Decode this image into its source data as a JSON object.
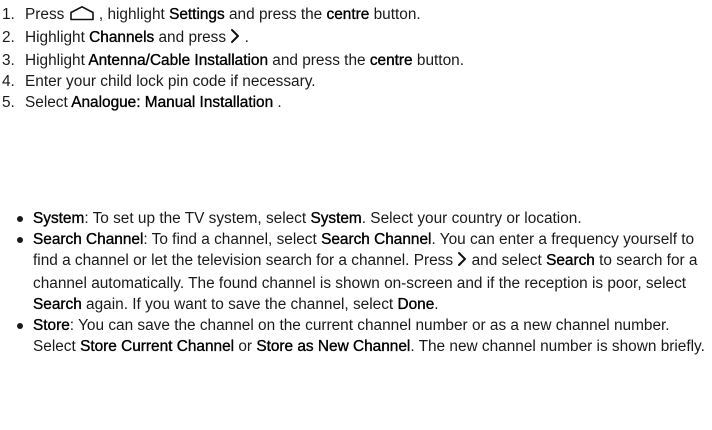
{
  "steps": [
    {
      "num": "1.",
      "t1": "Press ",
      "icon": "home-icon",
      "t2": ", highlight ",
      "k1": "Settings",
      "t3": " and press the ",
      "k2": "centre",
      "t4": " button."
    },
    {
      "num": "2.",
      "t1": "Highlight ",
      "k1": "Channels",
      "t2": " and press ",
      "icon": "chevron-right-icon",
      "t3": "."
    },
    {
      "num": "3.",
      "t1": "Highlight ",
      "k1": "Antenna/Cable Installation",
      "t2": " and press the ",
      "k2": "centre",
      "t3": " button."
    },
    {
      "num": "4.",
      "t1": "Enter your child lock pin code if necessary."
    },
    {
      "num": "5.",
      "t1": "Select ",
      "k1": "Analogue: Manual Installation",
      "t2": "."
    }
  ],
  "bullets": [
    {
      "k1": "System",
      "t1": ": To set up the TV system, select ",
      "k2": "System",
      "t2": ". Select your country or location."
    },
    {
      "k1": "Search Channel",
      "t1": ": To find a channel, select ",
      "k2": "Search Channel",
      "t2": ". You can enter a frequency yourself to find a channel or let the television search for a channel. Press ",
      "icon": "chevron-right-icon",
      "t3": " and select ",
      "k3": "Search",
      "t4": " to search for a channel automatically. The found channel is shown on-screen and if the reception is poor, select ",
      "k4": "Search",
      "t5": " again. If you want to save the channel, select ",
      "k5": "Done",
      "t6": "."
    },
    {
      "k1": "Store",
      "t1": ": You can save the channel on the current channel number or as a new channel number. Select ",
      "k2": "Store Current Channel",
      "t2": " or ",
      "k3": "Store as New Channel",
      "t3": ". The new channel number is shown briefly."
    }
  ]
}
